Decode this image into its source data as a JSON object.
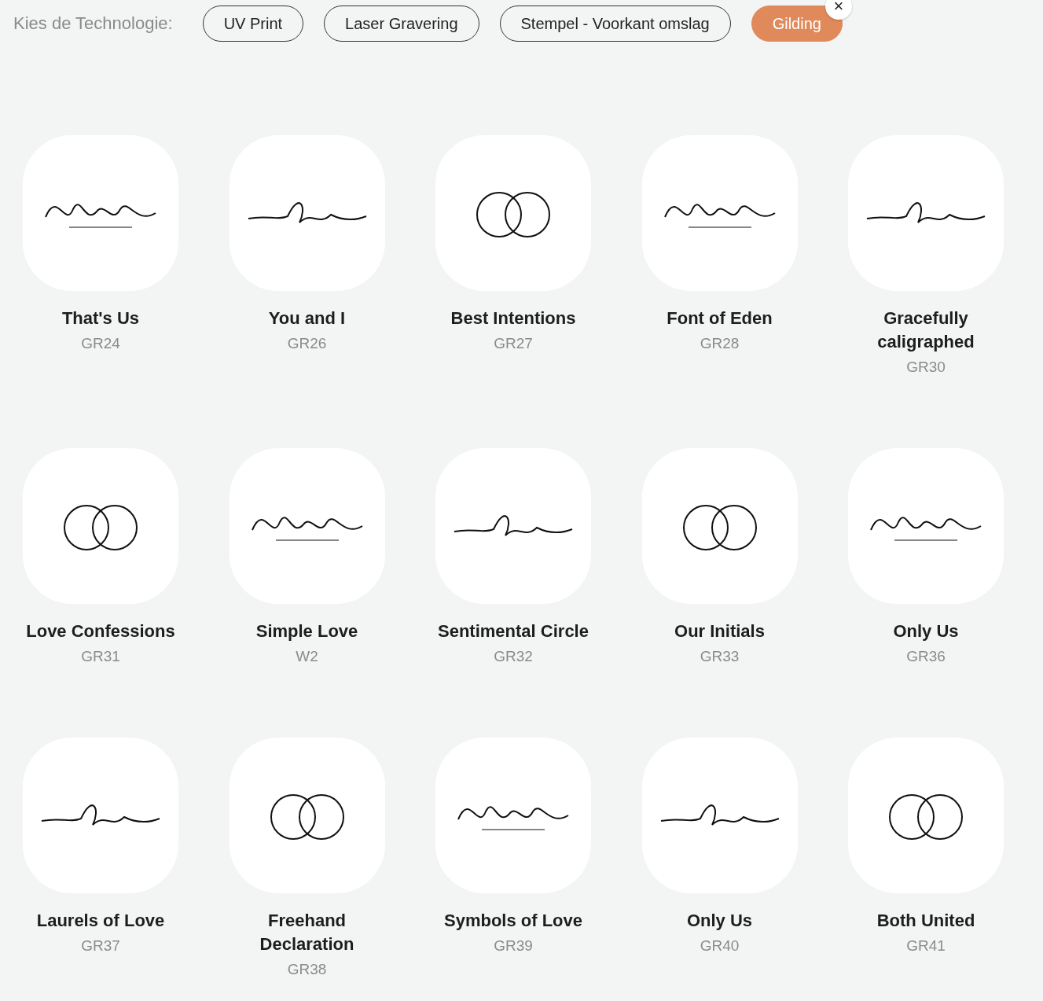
{
  "filter": {
    "label": "Kies de Technologie:",
    "options": [
      {
        "label": "UV Print",
        "selected": false
      },
      {
        "label": "Laser Gravering",
        "selected": false
      },
      {
        "label": "Stempel - Voorkant omslag",
        "selected": false
      },
      {
        "label": "Gilding",
        "selected": true
      }
    ],
    "clear_symbol": "×"
  },
  "designs": [
    {
      "name": "That's Us",
      "code": "GR24"
    },
    {
      "name": "You and I",
      "code": "GR26"
    },
    {
      "name": "Best Intentions",
      "code": "GR27"
    },
    {
      "name": "Font of Eden",
      "code": "GR28"
    },
    {
      "name": "Gracefully caligraphed",
      "code": "GR30"
    },
    {
      "name": "Love Confessions",
      "code": "GR31"
    },
    {
      "name": "Simple Love",
      "code": "W2"
    },
    {
      "name": "Sentimental Circle",
      "code": "GR32"
    },
    {
      "name": "Our Initials",
      "code": "GR33"
    },
    {
      "name": "Only Us",
      "code": "GR36"
    },
    {
      "name": "Laurels of Love",
      "code": "GR37"
    },
    {
      "name": "Freehand Declaration",
      "code": "GR38"
    },
    {
      "name": "Symbols of Love",
      "code": "GR39"
    },
    {
      "name": "Only Us",
      "code": "GR40"
    },
    {
      "name": "Both United",
      "code": "GR41"
    }
  ]
}
